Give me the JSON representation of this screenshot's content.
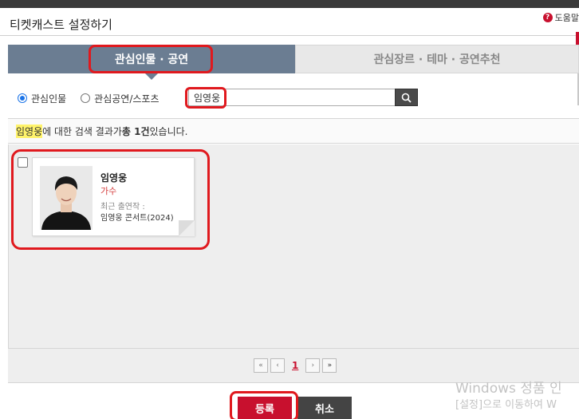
{
  "window": {
    "title": "티켓캐스트 설정하기",
    "help_label": "도움말"
  },
  "tabs": [
    {
      "label": "관심인물 · 공연",
      "active": true
    },
    {
      "label": "관심장르 · 테마 · 공연추천",
      "active": false
    }
  ],
  "search": {
    "radios": [
      {
        "label": "관심인물",
        "checked": true
      },
      {
        "label": "관심공연/스포츠",
        "checked": false
      }
    ],
    "value": "임영웅",
    "button_icon": "search-icon"
  },
  "result": {
    "keyword": "임영웅",
    "text_mid": "에 대한 검색 결과가 ",
    "count": "총 1건",
    "text_end": " 있습니다."
  },
  "cards": [
    {
      "name": "임영웅",
      "role": "가수",
      "recent_label": "최근 출연작 :",
      "recent_work": "임영웅 콘서트(2024)",
      "checked": false
    }
  ],
  "pager": {
    "current": "1",
    "first_icon": "first-page-icon",
    "prev_icon": "prev-page-icon",
    "next_icon": "next-page-icon",
    "last_icon": "last-page-icon"
  },
  "actions": {
    "register": "등록",
    "cancel": "취소"
  },
  "watermark": {
    "line1": "Windows 정품 인",
    "line2": "[설정]으로 이동하여 W"
  },
  "colors": {
    "accent": "#c8102e",
    "tab_active": "#6b7d92",
    "highlight": "#e0191e"
  }
}
